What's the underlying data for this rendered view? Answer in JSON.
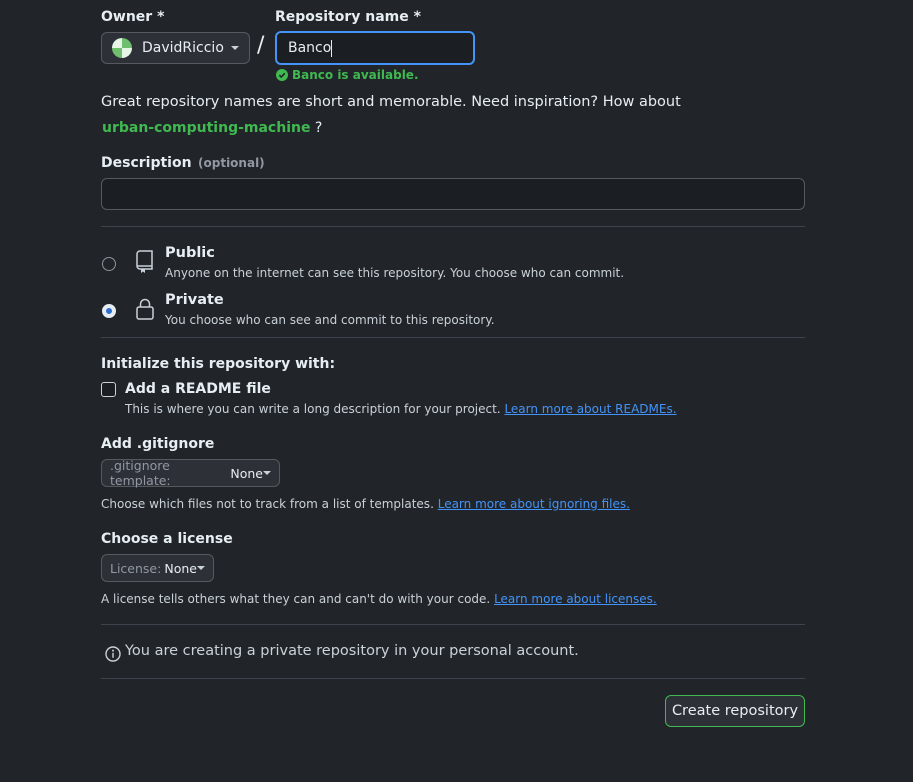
{
  "owner": {
    "label": "Owner *",
    "value": "DavidRiccio"
  },
  "separator": "/",
  "repo_name": {
    "label": "Repository name *",
    "value": "Banco",
    "availability": "Banco is available."
  },
  "suggestion": {
    "text": "Great repository names are short and memorable. Need inspiration? How about",
    "name": "urban-computing-machine",
    "suffix": "?"
  },
  "description": {
    "label": "Description",
    "optional": "(optional)",
    "value": ""
  },
  "visibility": {
    "public": {
      "title": "Public",
      "desc": "Anyone on the internet can see this repository. You choose who can commit."
    },
    "private": {
      "title": "Private",
      "desc": "You choose who can see and commit to this repository."
    },
    "selected": "private"
  },
  "init": {
    "heading": "Initialize this repository with:",
    "readme_label": "Add a README file",
    "readme_desc": "This is where you can write a long description for your project.",
    "readme_link": "Learn more about READMEs."
  },
  "gitignore": {
    "heading": "Add .gitignore",
    "button_prefix": ".gitignore template:",
    "button_value": "None",
    "desc": "Choose which files not to track from a list of templates.",
    "link": "Learn more about ignoring files."
  },
  "license": {
    "heading": "Choose a license",
    "button_prefix": "License:",
    "button_value": "None",
    "desc": "A license tells others what they can and can't do with your code.",
    "link": "Learn more about licenses."
  },
  "notice": "You are creating a private repository in your personal account.",
  "create_button": "Create repository",
  "colors": {
    "background": "#212529",
    "success": "#3fb950",
    "link": "#4493f8",
    "focus": "#4493f8",
    "radio_selected": "#2f6fd1"
  }
}
